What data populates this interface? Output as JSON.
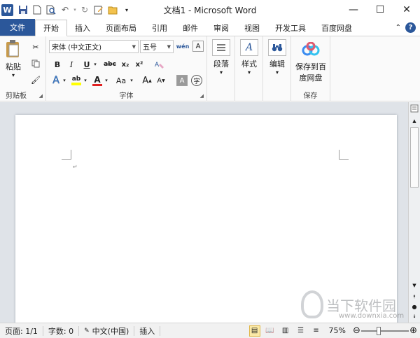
{
  "window": {
    "title": "文档1 - Microsoft Word",
    "app_icon_letter": "W",
    "controls": {
      "minimize": "—",
      "maximize": "☐",
      "close": "✕"
    }
  },
  "quick_access": [
    "save-icon",
    "new-doc-icon",
    "print-preview-icon",
    "undo-icon",
    "redo-icon",
    "edit-icon",
    "open-folder-icon",
    "customize-icon"
  ],
  "tabs": [
    "文件",
    "开始",
    "插入",
    "页面布局",
    "引用",
    "邮件",
    "审阅",
    "视图",
    "开发工具",
    "百度网盘"
  ],
  "active_tab": "开始",
  "ribbon": {
    "clipboard": {
      "label": "剪贴板",
      "paste_label": "粘贴",
      "paste_dropdown": "▾"
    },
    "font": {
      "label": "字体",
      "font_name": "宋体 (中文正文)",
      "font_size": "五号",
      "phonetic": "wén",
      "bold": "B",
      "italic": "I",
      "underline": "U",
      "strikethrough": "abc",
      "subscript": "x₂",
      "superscript": "x²",
      "text_effects": "A",
      "highlight": "ab",
      "font_color": "A",
      "change_case": "Aa",
      "grow_font": "A",
      "shrink_font": "A",
      "char_shading": "A",
      "enclose_char": "字"
    },
    "paragraph": {
      "label": "段落"
    },
    "styles": {
      "label": "样式"
    },
    "editing": {
      "label": "编辑"
    },
    "baidu": {
      "button_label_line1": "保存到百",
      "button_label_line2": "度网盘",
      "group_label": "保存"
    }
  },
  "document": {
    "paragraph_mark": "↵"
  },
  "status_bar": {
    "page": "页面: 1/1",
    "words": "字数: 0",
    "language": "中文(中国)",
    "mode": "插入",
    "zoom_text": "75%",
    "zoom_level_percent": 75
  },
  "watermark": {
    "text": "当下软件园",
    "url": "www.downxia.com"
  },
  "colors": {
    "accent": "#2b579a",
    "highlight_yellow": "#ffff00",
    "font_red": "#e02020",
    "baidu_blue": "#3b8cf0"
  }
}
